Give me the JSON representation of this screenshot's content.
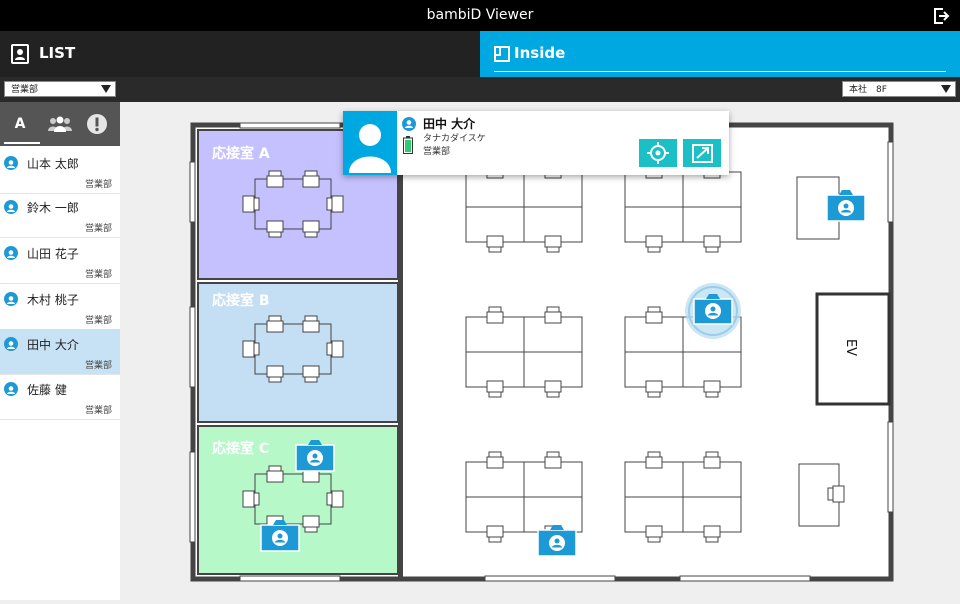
{
  "window": {
    "title": "bambiD Viewer"
  },
  "tabs": {
    "list": "LIST",
    "inside": "Inside"
  },
  "department_select": "営業部",
  "floor_select": "本社　8F",
  "filter_tabs": {
    "alpha": "A",
    "group_icon": "people-icon",
    "alert_icon": "alert-icon"
  },
  "people": [
    {
      "name": "山本 太郎",
      "dept": "営業部"
    },
    {
      "name": "鈴木 一郎",
      "dept": "営業部"
    },
    {
      "name": "山田 花子",
      "dept": "営業部"
    },
    {
      "name": "木村 桃子",
      "dept": "営業部"
    },
    {
      "name": "田中 大介",
      "dept": "営業部"
    },
    {
      "name": "佐藤 健",
      "dept": "営業部"
    }
  ],
  "rooms": {
    "a": "応接室 A",
    "b": "応接室 B",
    "c": "応接室 C",
    "ev": "EV"
  },
  "popup": {
    "name": "田中 大介",
    "kana": "タナカダイスケ",
    "dept": "営業部"
  },
  "colors": {
    "accent": "#00a8e2",
    "room_a": "#c5c1ff",
    "room_b": "#c4def3",
    "room_c": "#b6f8c8",
    "selected": "#c6e2f4",
    "button": "#1bbfc6"
  }
}
